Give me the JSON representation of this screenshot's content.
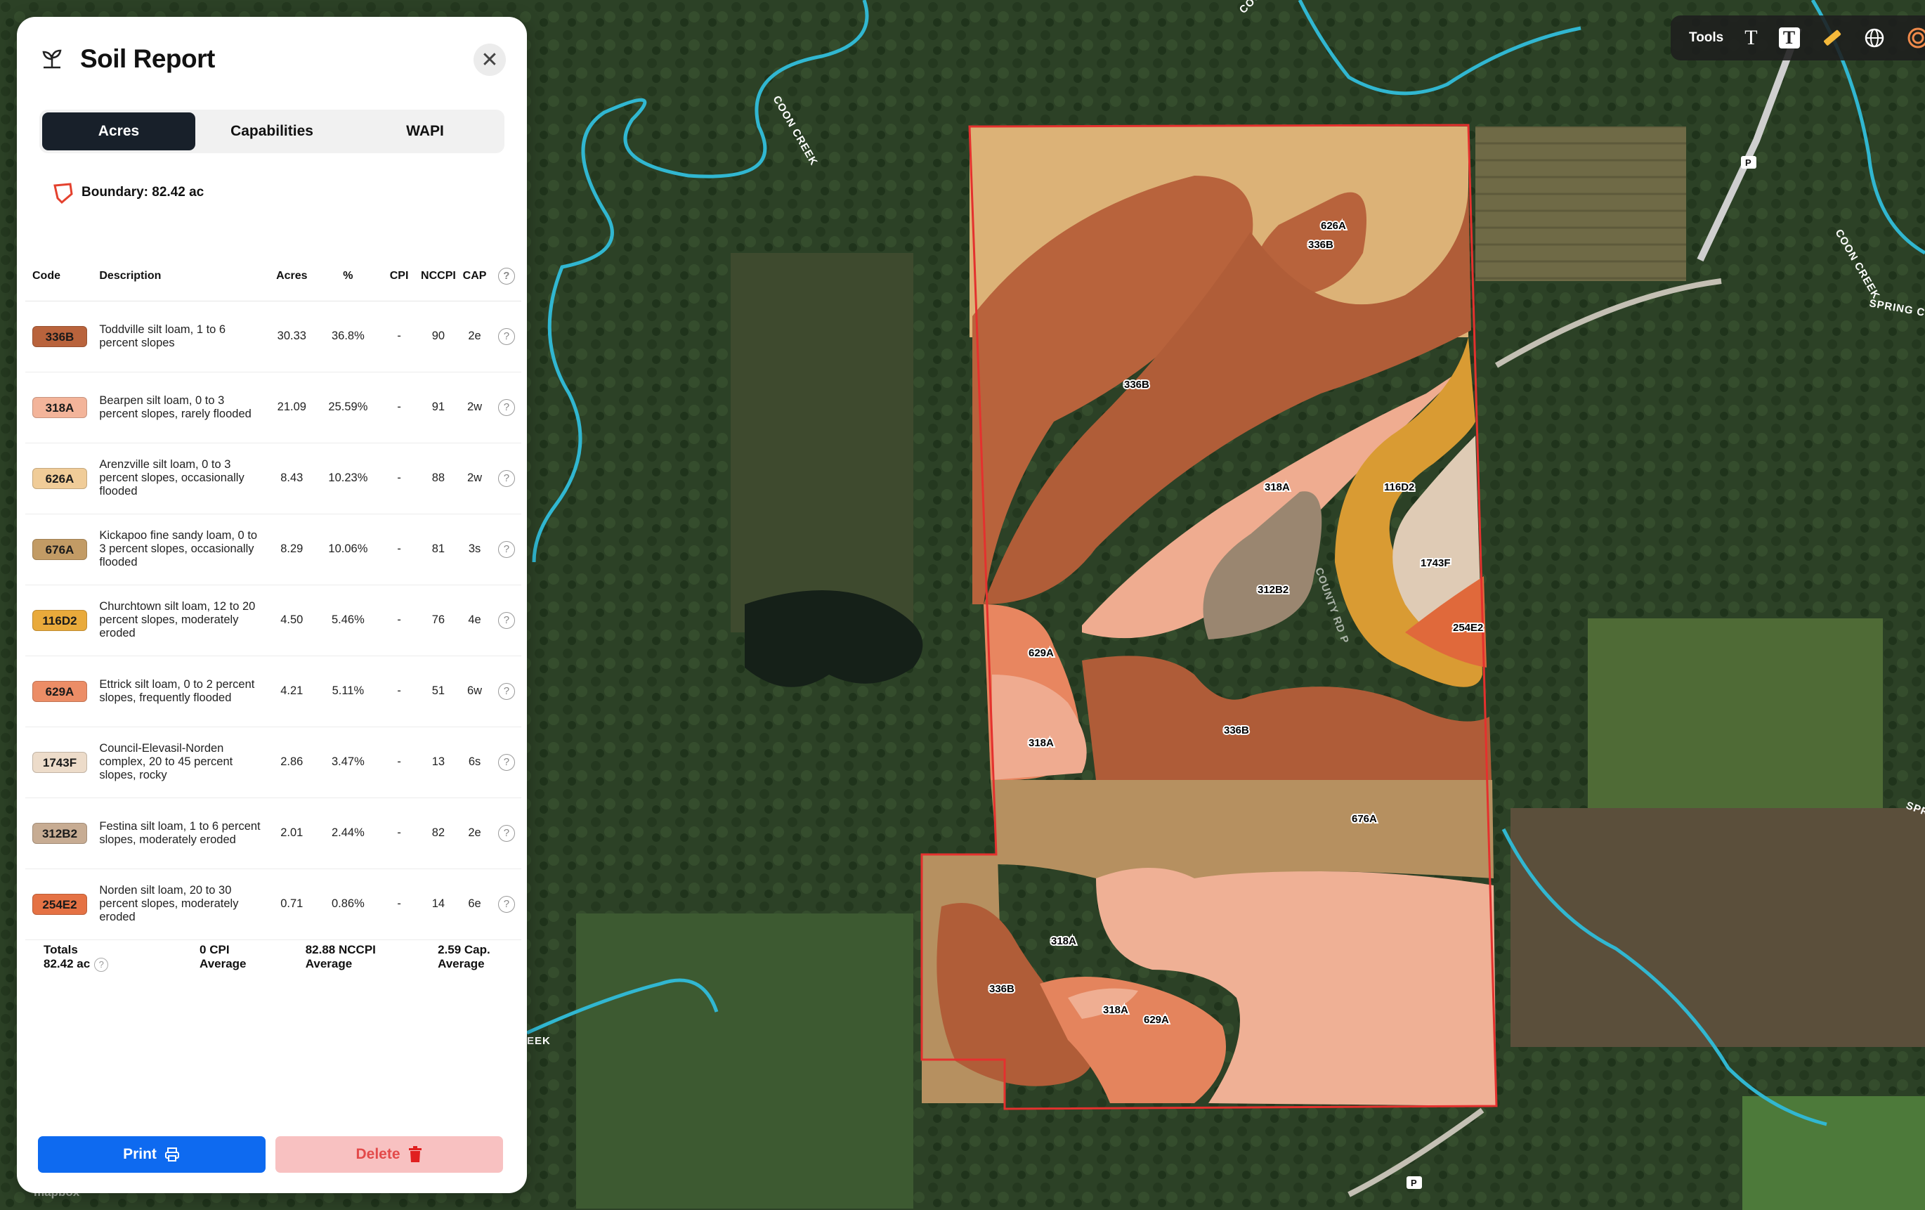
{
  "panel": {
    "title": "Soil Report",
    "close_icon": "close-icon",
    "tabs": [
      {
        "label": "Acres",
        "active": true
      },
      {
        "label": "Capabilities",
        "active": false
      },
      {
        "label": "WAPI",
        "active": false
      }
    ],
    "boundary_label": "Boundary: 82.42 ac",
    "columns": {
      "code": "Code",
      "description": "Description",
      "acres": "Acres",
      "pct": "%",
      "cpi": "CPI",
      "nccpi": "NCCPI",
      "cap": "CAP"
    },
    "rows": [
      {
        "code": "336B",
        "color": "#b9633c",
        "description": "Toddville silt loam, 1 to 6 percent slopes",
        "acres": "30.33",
        "pct": "36.8%",
        "cpi": "-",
        "nccpi": "90",
        "cap": "2e"
      },
      {
        "code": "318A",
        "color": "#f3b49a",
        "description": "Bearpen silt loam, 0 to 3 percent slopes, rarely flooded",
        "acres": "21.09",
        "pct": "25.59%",
        "cpi": "-",
        "nccpi": "91",
        "cap": "2w"
      },
      {
        "code": "626A",
        "color": "#f0cc98",
        "description": "Arenzville silt loam, 0 to 3 percent slopes, occasionally flooded",
        "acres": "8.43",
        "pct": "10.23%",
        "cpi": "-",
        "nccpi": "88",
        "cap": "2w"
      },
      {
        "code": "676A",
        "color": "#c29b65",
        "description": "Kickapoo fine sandy loam, 0 to 3 percent slopes, occasionally flooded",
        "acres": "8.29",
        "pct": "10.06%",
        "cpi": "-",
        "nccpi": "81",
        "cap": "3s"
      },
      {
        "code": "116D2",
        "color": "#e9aa3b",
        "description": "Churchtown silt loam, 12 to 20 percent slopes, moderately eroded",
        "acres": "4.50",
        "pct": "5.46%",
        "cpi": "-",
        "nccpi": "76",
        "cap": "4e"
      },
      {
        "code": "629A",
        "color": "#ec8d66",
        "description": "Ettrick silt loam, 0 to 2 percent slopes, frequently flooded",
        "acres": "4.21",
        "pct": "5.11%",
        "cpi": "-",
        "nccpi": "51",
        "cap": "6w"
      },
      {
        "code": "1743F",
        "color": "#eddcca",
        "description": "Council-Elevasil-Norden complex, 20 to 45 percent slopes, rocky",
        "acres": "2.86",
        "pct": "3.47%",
        "cpi": "-",
        "nccpi": "13",
        "cap": "6s"
      },
      {
        "code": "312B2",
        "color": "#c7ac93",
        "description": "Festina silt loam, 1 to 6 percent slopes, moderately eroded",
        "acres": "2.01",
        "pct": "2.44%",
        "cpi": "-",
        "nccpi": "82",
        "cap": "2e"
      },
      {
        "code": "254E2",
        "color": "#e57244",
        "description": "Norden silt loam, 20 to 30 percent slopes, moderately eroded",
        "acres": "0.71",
        "pct": "0.86%",
        "cpi": "-",
        "nccpi": "14",
        "cap": "6e"
      }
    ],
    "totals": {
      "label": "Totals",
      "acres": "82.42 ac",
      "cpi_value": "0 CPI",
      "cpi_sub": "Average",
      "nccpi_value": "82.88 NCCPI",
      "nccpi_sub": "Average",
      "cap_value": "2.59 Cap.",
      "cap_sub": "Average"
    },
    "print_label": "Print",
    "delete_label": "Delete"
  },
  "tools": {
    "label": "Tools",
    "items": [
      "text-icon",
      "text-box-icon",
      "ruler-icon",
      "globe-icon",
      "target-icon"
    ]
  },
  "map": {
    "road_labels": [
      "COON CREEK",
      "COON CREEK",
      "SPRING CO",
      "COO",
      "SPR",
      "EEK",
      "COUNTY RD P"
    ],
    "shield_label": "P",
    "zone_labels": [
      "626A",
      "336B",
      "336B",
      "318A",
      "116D2",
      "1743F",
      "312B2",
      "254E2",
      "629A",
      "318A",
      "336B",
      "676A",
      "318A",
      "336B",
      "318A",
      "629A"
    ],
    "attribution": "mapbox"
  }
}
